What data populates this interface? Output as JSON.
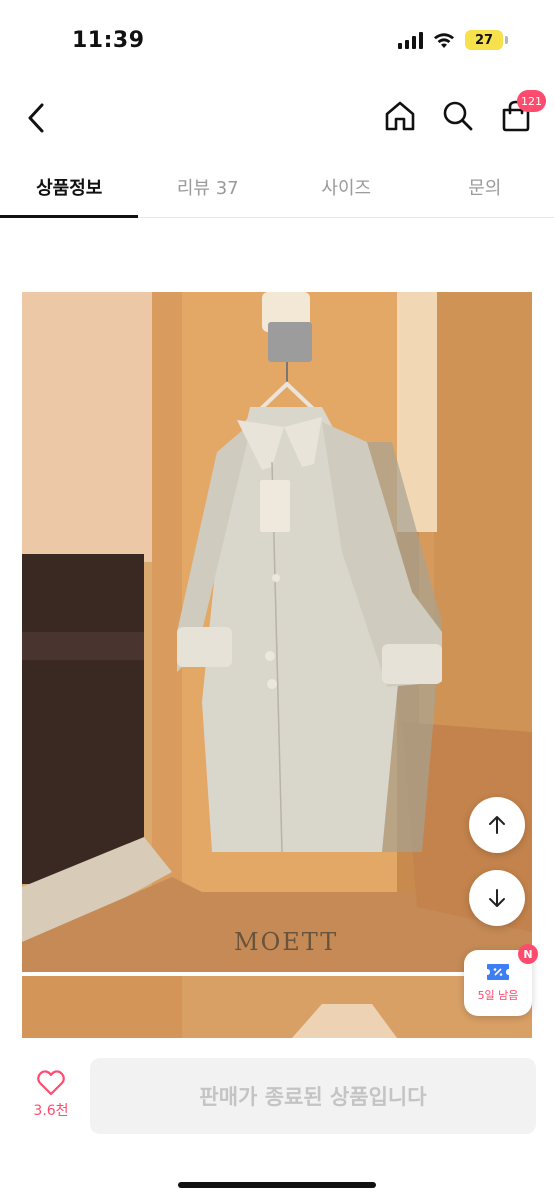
{
  "status_bar": {
    "time": "11:39",
    "battery": "27"
  },
  "nav": {
    "cart_count": "121"
  },
  "tabs": [
    {
      "label": "상품정보",
      "active": true
    },
    {
      "label": "리뷰 37",
      "active": false
    },
    {
      "label": "사이즈",
      "active": false
    },
    {
      "label": "문의",
      "active": false
    }
  ],
  "product": {
    "image_watermark": "MOETT"
  },
  "floating": {
    "coupon_label": "5일 남음",
    "coupon_badge": "N"
  },
  "bottom": {
    "like_count": "3.6천",
    "sold_out_label": "판매가 종료된 상품입니다"
  },
  "colors": {
    "accent": "#ff4b6e",
    "disabled_bg": "#f2f2f2",
    "disabled_text": "#c4c4c4"
  }
}
